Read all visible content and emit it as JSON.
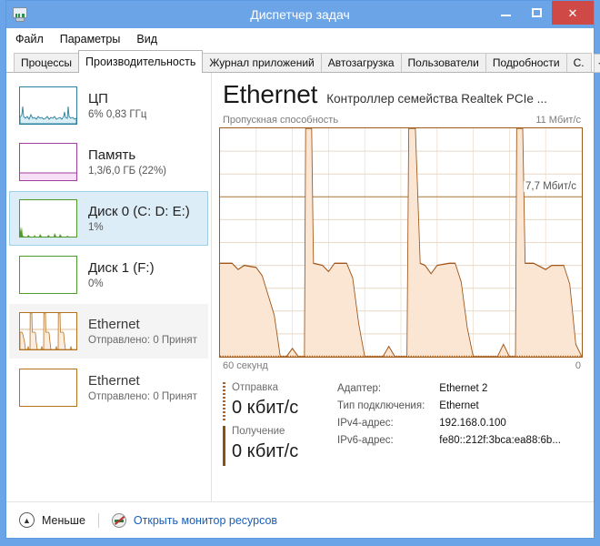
{
  "window": {
    "title": "Диспетчер задач",
    "icon": "task-manager-icon",
    "minimize_label": "—",
    "maximize_label": "□",
    "close_label": "✕"
  },
  "menu": {
    "items": [
      "Файл",
      "Параметры",
      "Вид"
    ]
  },
  "tabs": {
    "items": [
      {
        "label": "Процессы",
        "active": false
      },
      {
        "label": "Производительность",
        "active": true
      },
      {
        "label": "Журнал приложений",
        "active": false
      },
      {
        "label": "Автозагрузка",
        "active": false
      },
      {
        "label": "Пользователи",
        "active": false
      },
      {
        "label": "Подробности",
        "active": false
      },
      {
        "label": "С.",
        "active": false
      }
    ],
    "scroll_left": "◄",
    "scroll_right": "►"
  },
  "sidebar": {
    "items": [
      {
        "title": "ЦП",
        "sub": "6% 0,83 ГГц",
        "color": "#2b7f9e",
        "fill": "#ffffff",
        "state": "normal",
        "kind": "cpu"
      },
      {
        "title": "Память",
        "sub": "1,3/6,0 ГБ (22%)",
        "color": "#a03fa0",
        "fill": "#fbeefb",
        "state": "normal",
        "kind": "memory"
      },
      {
        "title": "Диск 0 (C: D: E:)",
        "sub": "1%",
        "color": "#4f9a2a",
        "fill": "#ffffff",
        "state": "selected",
        "kind": "disk"
      },
      {
        "title": "Диск 1 (F:)",
        "sub": "0%",
        "color": "#4f9a2a",
        "fill": "#ffffff",
        "state": "normal",
        "kind": "disk-idle"
      },
      {
        "title": "Ethernet",
        "sub": "Отправлено: 0 Принят",
        "color": "#b4721f",
        "fill": "#ffffff",
        "state": "hover",
        "kind": "net-active"
      },
      {
        "title": "Ethernet",
        "sub": "Отправлено: 0 Принят",
        "color": "#b4721f",
        "fill": "#ffffff",
        "state": "normal",
        "kind": "net-idle"
      }
    ]
  },
  "main": {
    "title": "Ethernet",
    "subtitle": "Контроллер семейства Realtek PCIe ...",
    "throughput_label": "Пропускная способность",
    "throughput_max": "11 Мбит/с",
    "marker_label": "7,7 Мбит/с",
    "time_left": "60 секунд",
    "time_right": "0",
    "send": {
      "label": "Отправка",
      "value": "0 кбит/с",
      "color": "#b4611f"
    },
    "receive": {
      "label": "Получение",
      "value": "0 кбит/с",
      "color": "#8a5014"
    },
    "info": [
      {
        "key": "Адаптер:",
        "value": "Ethernet 2"
      },
      {
        "key": "Тип подключения:",
        "value": "Ethernet"
      },
      {
        "key": "IPv4-адрес:",
        "value": "192.168.0.100"
      },
      {
        "key": "IPv6-адрес:",
        "value": "fe80::212f:3bca:ea88:6b..."
      }
    ]
  },
  "footer": {
    "less_label": "Меньше",
    "chevron": "︿",
    "resource_monitor_label": "Открыть монитор ресурсов"
  },
  "chart_data": {
    "type": "area",
    "title": "Пропускная способность",
    "ylabel": "Мбит/с",
    "xlabel": "секунд",
    "ylim": [
      0,
      11
    ],
    "xlim": [
      60,
      0
    ],
    "grid": true,
    "y_gridlines": [
      1.1,
      2.2,
      3.3,
      4.4,
      5.5,
      6.6,
      7.7,
      8.8,
      9.9
    ],
    "x_gridlines": [
      6,
      12,
      18,
      24,
      30,
      36,
      42,
      48,
      54
    ],
    "marker_value": 7.7,
    "marker_label": "7,7 Мбит/с",
    "max_label": "11 Мбит/с",
    "series": [
      {
        "name": "Отправка",
        "color": "#b4611f",
        "style": "dotted",
        "values": [
          0,
          0,
          0,
          0,
          0,
          0,
          0,
          0,
          0,
          0,
          0,
          0,
          0,
          0,
          0,
          0,
          0,
          0,
          0,
          0
        ]
      },
      {
        "name": "Получение",
        "color": "#a0561a",
        "style": "solid",
        "fill": "#fae6d2",
        "points": [
          [
            0,
            4.5
          ],
          [
            2,
            4.5
          ],
          [
            3,
            4.2
          ],
          [
            4,
            4.4
          ],
          [
            6,
            4.3
          ],
          [
            7,
            3.9
          ],
          [
            9,
            2.0
          ],
          [
            10,
            0.0
          ],
          [
            11,
            0.0
          ],
          [
            12,
            0.4
          ],
          [
            13,
            0.0
          ],
          [
            14,
            0.0
          ],
          [
            14.2,
            11.0
          ],
          [
            15.2,
            11.0
          ],
          [
            15.5,
            4.5
          ],
          [
            17,
            4.4
          ],
          [
            18,
            4.1
          ],
          [
            19,
            4.5
          ],
          [
            21,
            4.5
          ],
          [
            22,
            3.8
          ],
          [
            23,
            1.6
          ],
          [
            24,
            0.0
          ],
          [
            27,
            0.0
          ],
          [
            28,
            0.5
          ],
          [
            29,
            0.0
          ],
          [
            31,
            0.0
          ],
          [
            31.3,
            11.0
          ],
          [
            32.4,
            11.0
          ],
          [
            33.2,
            4.5
          ],
          [
            34,
            4.4
          ],
          [
            35,
            4.0
          ],
          [
            36,
            4.4
          ],
          [
            38,
            4.5
          ],
          [
            39,
            4.5
          ],
          [
            40,
            3.6
          ],
          [
            41,
            1.4
          ],
          [
            42,
            0.0
          ],
          [
            46,
            0.0
          ],
          [
            47,
            0.6
          ],
          [
            48,
            0.0
          ],
          [
            49,
            0.0
          ],
          [
            49.2,
            11.0
          ],
          [
            50.2,
            11.0
          ],
          [
            50.6,
            4.5
          ],
          [
            52,
            4.5
          ],
          [
            54,
            4.2
          ],
          [
            55,
            4.4
          ],
          [
            57,
            4.4
          ],
          [
            58,
            3.5
          ],
          [
            59,
            0.6
          ],
          [
            60,
            0.0
          ]
        ]
      }
    ]
  }
}
